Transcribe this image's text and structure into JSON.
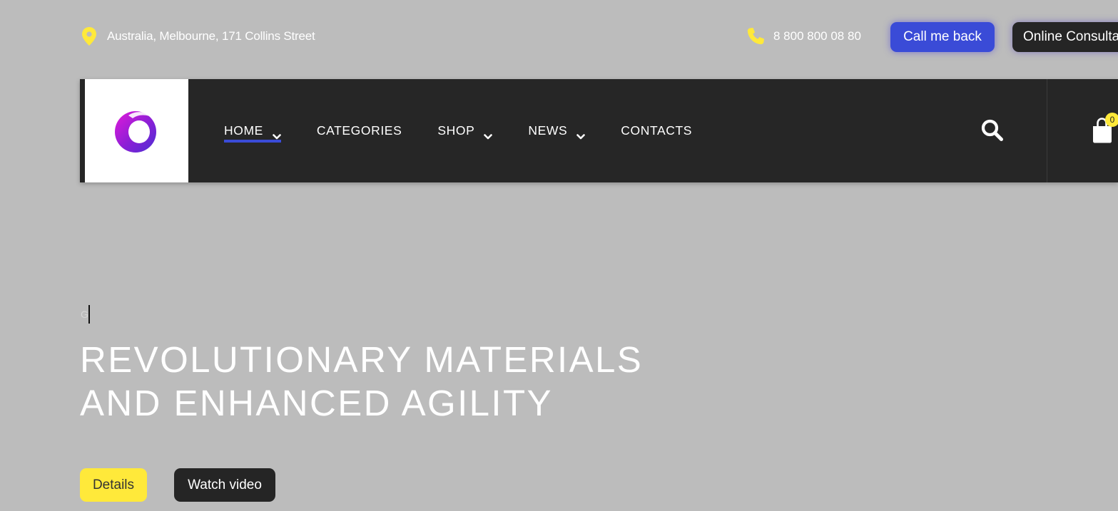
{
  "topbar": {
    "address": "Australia, Melbourne, 171 Collins Street",
    "phone": "8 800 800 08 80",
    "call_back_label": "Call me back",
    "consult_label": "Online Consultation",
    "icons": {
      "address": "map-pin-icon",
      "phone": "phone-icon"
    },
    "icon_color": "#ffe93a"
  },
  "header": {
    "logo": "brand-logo",
    "nav": [
      {
        "label": "HOME",
        "has_dropdown": true,
        "active": true
      },
      {
        "label": "CATEGORIES",
        "has_dropdown": false,
        "active": false
      },
      {
        "label": "SHOP",
        "has_dropdown": true,
        "active": false
      },
      {
        "label": "NEWS",
        "has_dropdown": true,
        "active": false
      },
      {
        "label": "CONTACTS",
        "has_dropdown": false,
        "active": false
      }
    ],
    "cart_count": "0",
    "icons": {
      "search": "search-icon",
      "cart": "shopping-bag-icon"
    }
  },
  "hero": {
    "small_text": "G",
    "title_line1": "REVOLUTIONARY MATERIALS",
    "title_line2": "AND ENHANCED AGILITY",
    "details_label": "Details",
    "video_label": "Watch video"
  },
  "colors": {
    "accent_blue": "#3a4bd7",
    "accent_yellow": "#ffe93a",
    "dark": "#262626",
    "background": "#bcbcbc"
  }
}
